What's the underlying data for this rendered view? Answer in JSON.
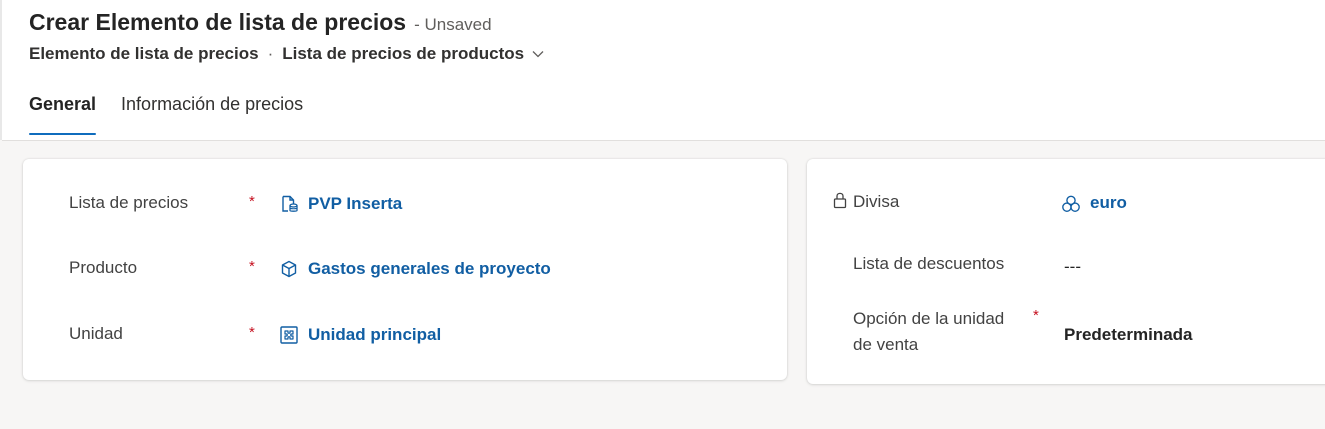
{
  "header": {
    "title": "Crear Elemento de lista de precios",
    "status": "- Unsaved",
    "entity_name": "Elemento de lista de precios",
    "separator": "·",
    "form_name": "Lista de precios de productos"
  },
  "tabs": [
    {
      "label": "General",
      "active": true
    },
    {
      "label": "Información de precios",
      "active": false
    }
  ],
  "left_card": {
    "fields": [
      {
        "label": "Lista de precios",
        "required": "*",
        "value": "PVP Inserta",
        "icon": "price-list-icon"
      },
      {
        "label": "Producto",
        "required": "*",
        "value": "Gastos generales de proyecto",
        "icon": "product-box-icon"
      },
      {
        "label": "Unidad",
        "required": "*",
        "value": "Unidad principal",
        "icon": "unit-icon"
      }
    ]
  },
  "right_card": {
    "currency": {
      "label": "Divisa",
      "value": "euro",
      "icon": "currency-icon",
      "locked_icon": "lock-icon"
    },
    "discount_list": {
      "label": "Lista de descuentos",
      "value": "---"
    },
    "sale_unit_option": {
      "label_line1": "Opción de la unidad",
      "label_line2": "de venta",
      "required": "*",
      "value": "Predeterminada"
    }
  },
  "colors": {
    "accent": "#0f6cbd",
    "link": "#115ea3",
    "required": "#c50f1f",
    "background": "#f7f6f5"
  }
}
